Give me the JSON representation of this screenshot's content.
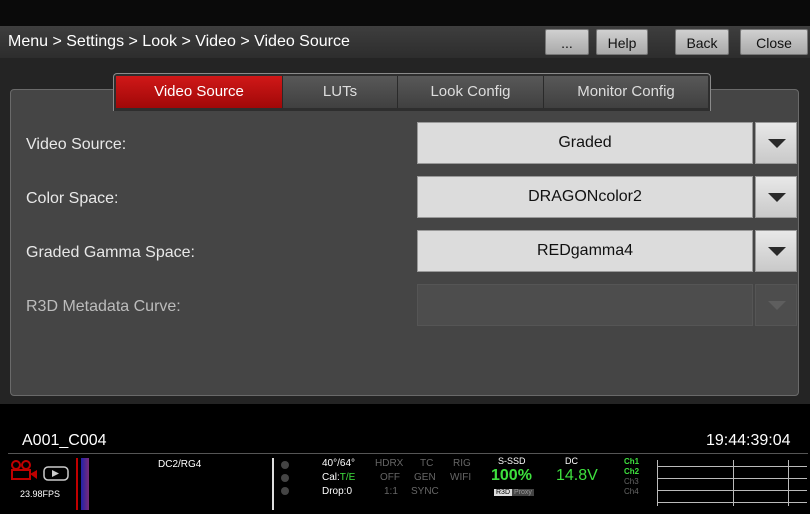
{
  "header": {
    "breadcrumb": "Menu > Settings > Look > Video > Video Source",
    "buttons": {
      "more": "...",
      "help": "Help",
      "back": "Back",
      "close": "Close"
    }
  },
  "tabs": [
    {
      "label": "Video Source",
      "active": true
    },
    {
      "label": "LUTs",
      "active": false
    },
    {
      "label": "Look Config",
      "active": false
    },
    {
      "label": "Monitor Config",
      "active": false
    }
  ],
  "settings": [
    {
      "label": "Video Source:",
      "value": "Graded",
      "enabled": true
    },
    {
      "label": "Color Space:",
      "value": "DRAGONcolor2",
      "enabled": true
    },
    {
      "label": "Graded Gamma Space:",
      "value": "REDgamma4",
      "enabled": true
    },
    {
      "label": "R3D Metadata Curve:",
      "value": "",
      "enabled": false
    }
  ],
  "status": {
    "clip_name": "A001_C004",
    "timecode": "19:44:39:04",
    "fps": "23.98FPS",
    "look": "DC2/RG4",
    "shutter": "40°/64°",
    "cal_label": "Cal:",
    "cal_value": "T/E",
    "drop": "Drop:0",
    "hdrx": "HDRX",
    "off": "OFF",
    "ratio": "1:1",
    "tc": "TC",
    "gen": "GEN",
    "sync": "SYNC",
    "rig": "RIG",
    "wifi": "WIFI",
    "media_label": "S-SSD",
    "media_value": "100%",
    "r3d_tag": "R3D",
    "proxy_tag": "Proxy",
    "power_label": "DC",
    "power_value": "14.8V",
    "channels": [
      "Ch1",
      "Ch2",
      "Ch3",
      "Ch4"
    ],
    "colors": {
      "accent_red": "#c00000",
      "status_green": "#3ee03e"
    }
  }
}
